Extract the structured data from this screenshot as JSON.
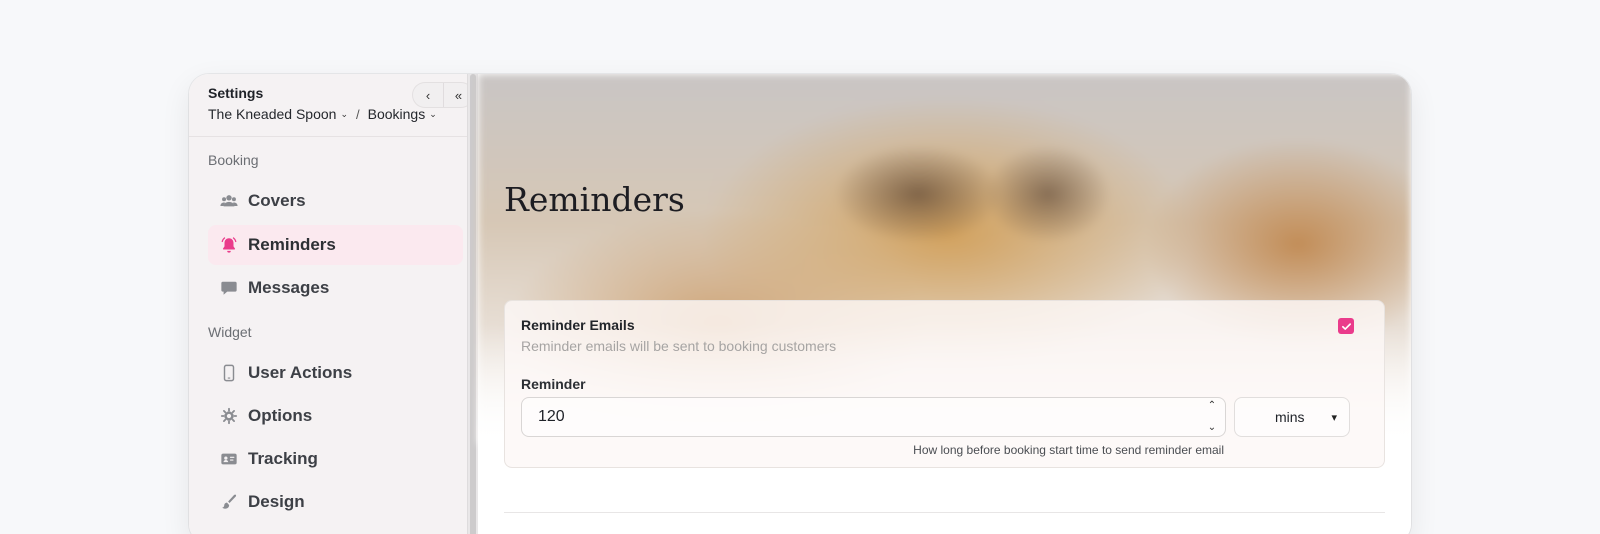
{
  "sidebar": {
    "title": "Settings",
    "breadcrumb": [
      {
        "label": "The Kneaded Spoon"
      },
      {
        "label": "Bookings"
      }
    ],
    "breadcrumb_separator": "/",
    "collapse_icons": [
      "chevron-left-icon",
      "double-chevron-left-icon"
    ],
    "sections": [
      {
        "label": "Booking",
        "items": [
          {
            "label": "Covers",
            "icon": "users-icon",
            "active": false
          },
          {
            "label": "Reminders",
            "icon": "bell-icon",
            "active": true
          },
          {
            "label": "Messages",
            "icon": "message-icon",
            "active": false
          }
        ]
      },
      {
        "label": "Widget",
        "items": [
          {
            "label": "User Actions",
            "icon": "mobile-icon",
            "active": false
          },
          {
            "label": "Options",
            "icon": "gear-icon",
            "active": false
          },
          {
            "label": "Tracking",
            "icon": "id-card-icon",
            "active": false
          },
          {
            "label": "Design",
            "icon": "brush-icon",
            "active": false
          }
        ]
      }
    ]
  },
  "main": {
    "title": "Reminders",
    "card": {
      "title": "Reminder Emails",
      "subtitle": "Reminder emails will be sent to booking customers",
      "enabled": true,
      "field_label": "Reminder",
      "value": "120",
      "unit": "mins",
      "hint": "How long before booking start time to send reminder email"
    }
  },
  "colors": {
    "accent": "#ea3b8b",
    "active_bg": "#fbe9ef",
    "sidebar_bg": "#f5f2f3"
  }
}
